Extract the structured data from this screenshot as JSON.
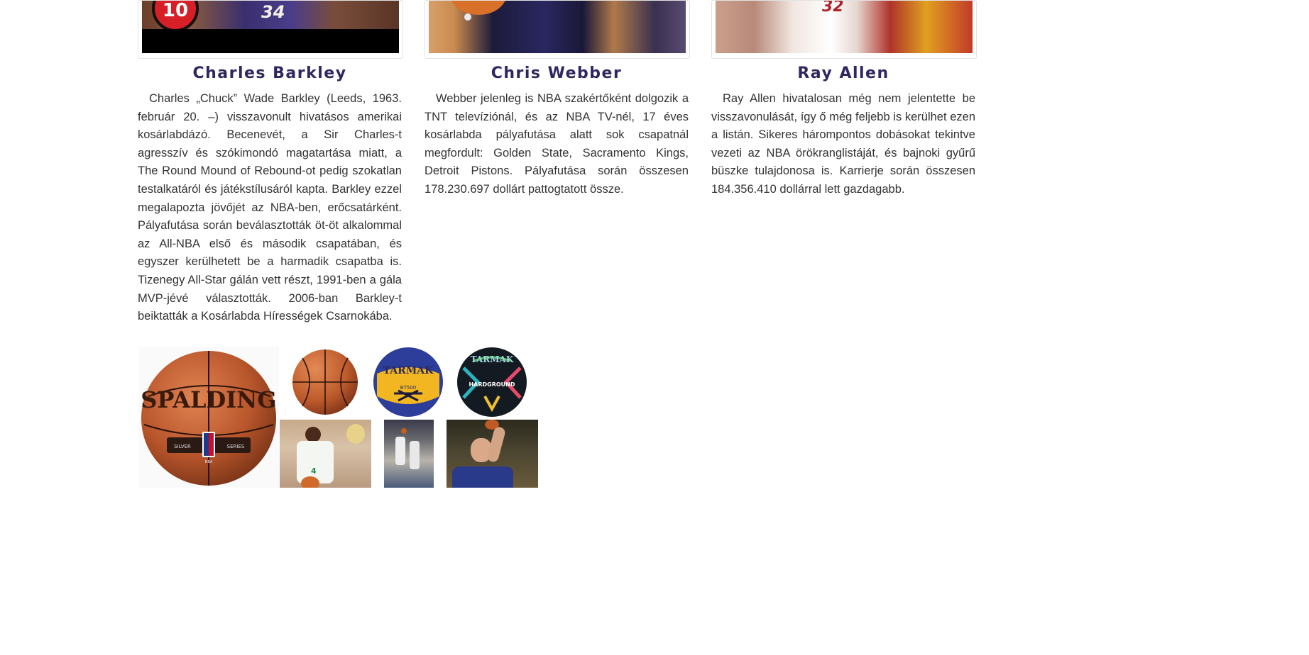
{
  "cards": [
    {
      "name": "Charles Barkley",
      "badge_number": "10",
      "jersey_number": "34",
      "bio": "Charles „Chuck” Wade Barkley (Leeds, 1963. február 20. –) visszavonult hivatásos amerikai kosárlabdázó. Becenevét, a Sir Charles-t agresszív és szókimondó magatartása miatt, a The Round Mound of Rebound-ot pedig szokatlan testalkatáról és játékstílusáról kapta. Barkley ezzel megalapozta jövőjét az NBA-ben, erőcsatárként. Pályafutása során beválasztották öt-öt alkalommal az All-NBA első és második csapatában, és egyszer kerülhetett be a harmadik csapatba is. Tizenegy All-Star gálán vett részt, 1991-ben a gála MVP-jévé választották. 2006-ban Barkley-t beiktatták a Kosárlabda Hírességek Csarnokába."
    },
    {
      "name": "Chris Webber",
      "bio": "Webber jelenleg is NBA szakértőként dolgozik a TNT televíziónál, és az NBA TV-nél, 17 éves kosárlabda pályafutása alatt sok csapatnál megfordult: Golden State, Sacramento Kings, Detroit Pistons. Pályafutása során összesen 178.230.697 dollárt pattogtatott össze."
    },
    {
      "name": "Ray Allen",
      "jersey_number": "32",
      "bio": "Ray Allen hivatalosan még nem jelentette be visszavonulását, így ő még feljebb is kerülhet ezen a listán. Sikeres hárompontos dobásokat tekintve vezeti az NBA örökranglistáját, és bajnoki gyűrű büszke tulajdonosa is. Karrierje során összesen 184.356.410 dollárral lett gazdagabb."
    }
  ],
  "gallery": {
    "spalding": {
      "brand": "SPALDING",
      "line1": "SILVER",
      "line2": "SERIES",
      "logo": "NBA"
    },
    "tarmak_yellow": {
      "brand": "TARMAK",
      "model": "BT500"
    },
    "tarmak_dark": {
      "brand": "TARMAK",
      "model": "HARDGROUND"
    },
    "player_jersey": "4"
  }
}
